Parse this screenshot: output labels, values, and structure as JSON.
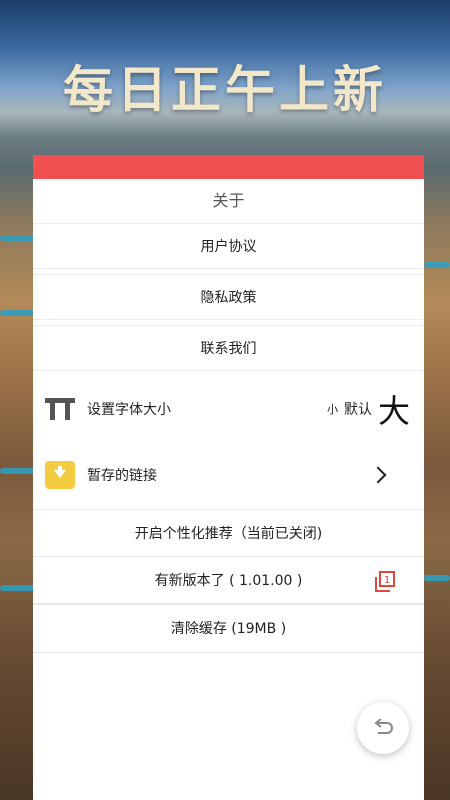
{
  "banner": {
    "headline": "每日正午上新"
  },
  "about": {
    "title": "关于"
  },
  "links": [
    {
      "label": "用户协议"
    },
    {
      "label": "隐私政策"
    },
    {
      "label": "联系我们"
    }
  ],
  "font_size": {
    "label": "设置字体大小",
    "options": {
      "small": "小",
      "default": "默认",
      "large": "大"
    },
    "icon": "font-size-icon"
  },
  "saved_links": {
    "label": "暂存的链接",
    "icon": "folder-download-icon"
  },
  "personalization": {
    "label": "开启个性化推荐（当前已关闭)"
  },
  "update": {
    "label": "有新版本了 ( 1.01.00 )",
    "badge": "1",
    "icon": "copy-badge-icon"
  },
  "cache": {
    "label": "清除缓存 (19MB )"
  },
  "fab": {
    "icon": "undo-icon"
  },
  "colors": {
    "accent": "#f05050",
    "folder": "#f4cc3f",
    "update_icon": "#e0453e"
  }
}
